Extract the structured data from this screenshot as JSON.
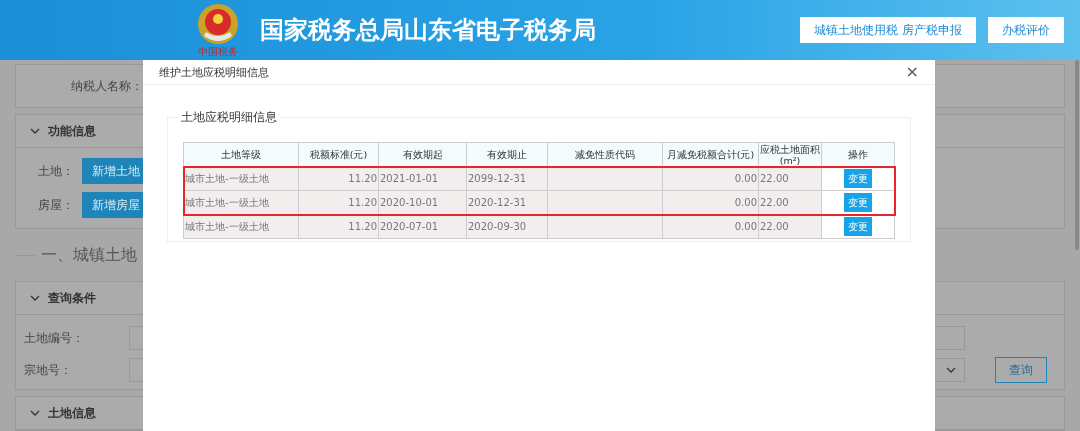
{
  "header": {
    "logo_text": "中国税务",
    "title": "国家税务总局山东省电子税务局",
    "buttons": [
      "城镇土地使用税 房产税申报",
      "办税评价"
    ]
  },
  "background_page": {
    "taxpayer_label": "纳税人名称：",
    "function_panel": {
      "title": "功能信息",
      "rows": [
        {
          "label": "土地：",
          "button": "新增土地"
        },
        {
          "label": "房屋：",
          "button": "新增房屋"
        }
      ]
    },
    "section_heading": "一、城镇土地",
    "query_panel": {
      "title": "查询条件",
      "fields": [
        {
          "label": "土地编号：",
          "kind": "text"
        },
        {
          "label": "宗地号：",
          "kind": "select"
        }
      ],
      "query_button": "查询"
    },
    "land_panel": {
      "title": "土地信息"
    }
  },
  "dialog": {
    "title": "维护土地应税明细信息",
    "close": "×",
    "fieldset_legend": "土地应税明细信息",
    "table": {
      "columns": [
        "土地等级",
        "税额标准(元)",
        "有效期起",
        "有效期止",
        "减免性质代码",
        "月减免税额合计(元)",
        "应税土地面积(m²)",
        "操作"
      ],
      "rows": [
        {
          "cells": [
            "城市土地-一级土地",
            "11.20",
            "2021-01-01",
            "2099-12-31",
            "",
            "0.00",
            "22.00"
          ],
          "action": "变更",
          "highlighted": true
        },
        {
          "cells": [
            "城市土地-一级土地",
            "11.20",
            "2020-10-01",
            "2020-12-31",
            "",
            "0.00",
            "22.00"
          ],
          "action": "变更",
          "highlighted": true
        },
        {
          "cells": [
            "城市土地-一级土地",
            "11.20",
            "2020-07-01",
            "2020-09-30",
            "",
            "0.00",
            "22.00"
          ],
          "action": "变更",
          "highlighted": false
        }
      ]
    }
  }
}
